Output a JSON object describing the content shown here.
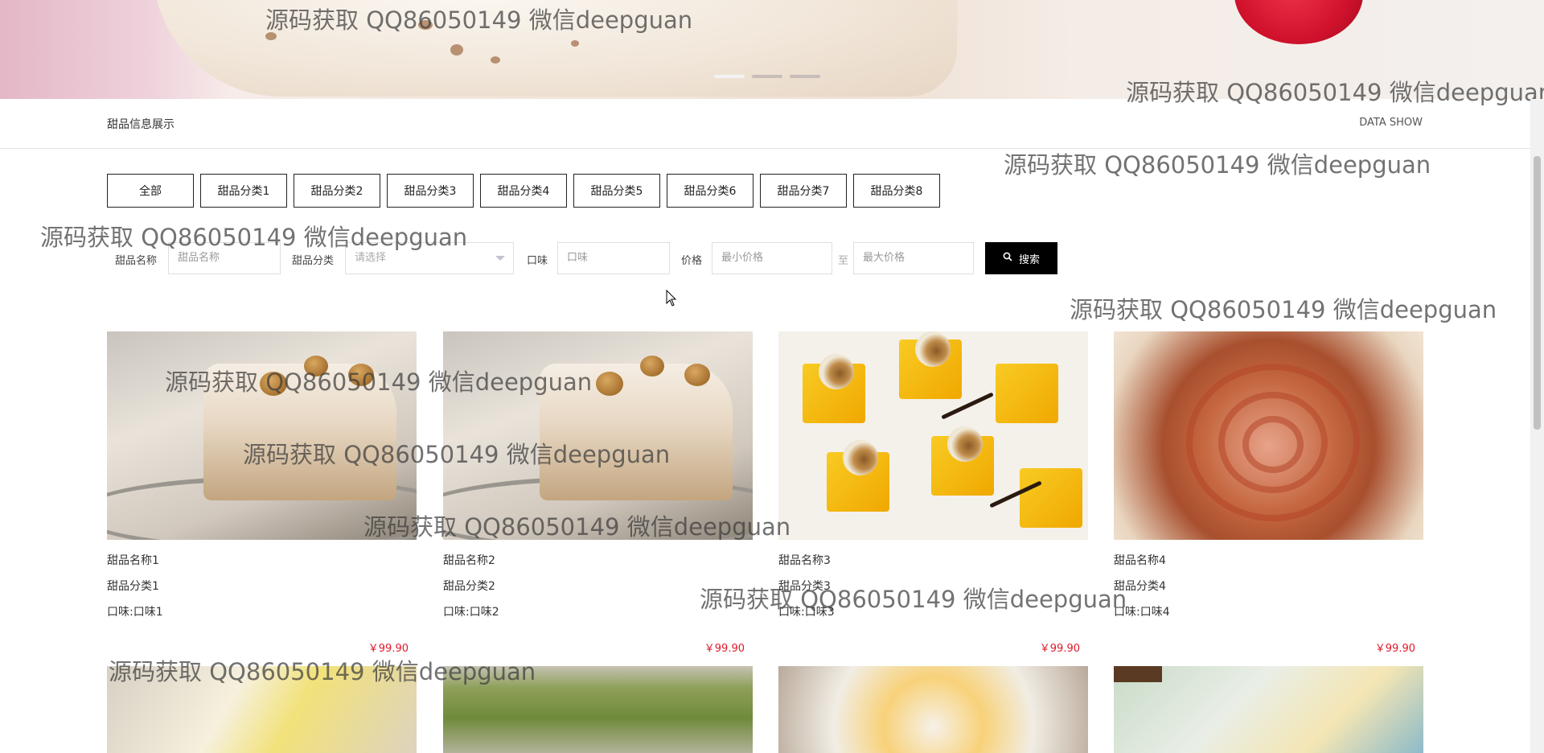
{
  "section": {
    "title": "甜品信息展示",
    "subtitle": "DATA SHOW"
  },
  "tabs": [
    "全部",
    "甜品分类1",
    "甜品分类2",
    "甜品分类3",
    "甜品分类4",
    "甜品分类5",
    "甜品分类6",
    "甜品分类7",
    "甜品分类8"
  ],
  "search": {
    "name_label": "甜品名称",
    "name_placeholder": "甜品名称",
    "category_label": "甜品分类",
    "category_placeholder": "请选择",
    "taste_label": "口味",
    "taste_placeholder": "口味",
    "price_label": "价格",
    "min_placeholder": "最小价格",
    "sep": "至",
    "max_placeholder": "最大价格",
    "button_label": "搜索"
  },
  "products": [
    {
      "name": "甜品名称1",
      "category": "甜品分类1",
      "taste": "口味:口味1",
      "price": "￥99.90"
    },
    {
      "name": "甜品名称2",
      "category": "甜品分类2",
      "taste": "口味:口味2",
      "price": "￥99.90"
    },
    {
      "name": "甜品名称3",
      "category": "甜品分类3",
      "taste": "口味:口味3",
      "price": "￥99.90"
    },
    {
      "name": "甜品名称4",
      "category": "甜品分类4",
      "taste": "口味:口味4",
      "price": "￥99.90"
    }
  ],
  "watermark": "源码获取 QQ86050149 微信deepguan",
  "banner": {
    "slides": 3,
    "active_slide": 1
  },
  "colors": {
    "price": "#e0192a",
    "button_bg": "#000000",
    "tab_border": "#222222"
  }
}
